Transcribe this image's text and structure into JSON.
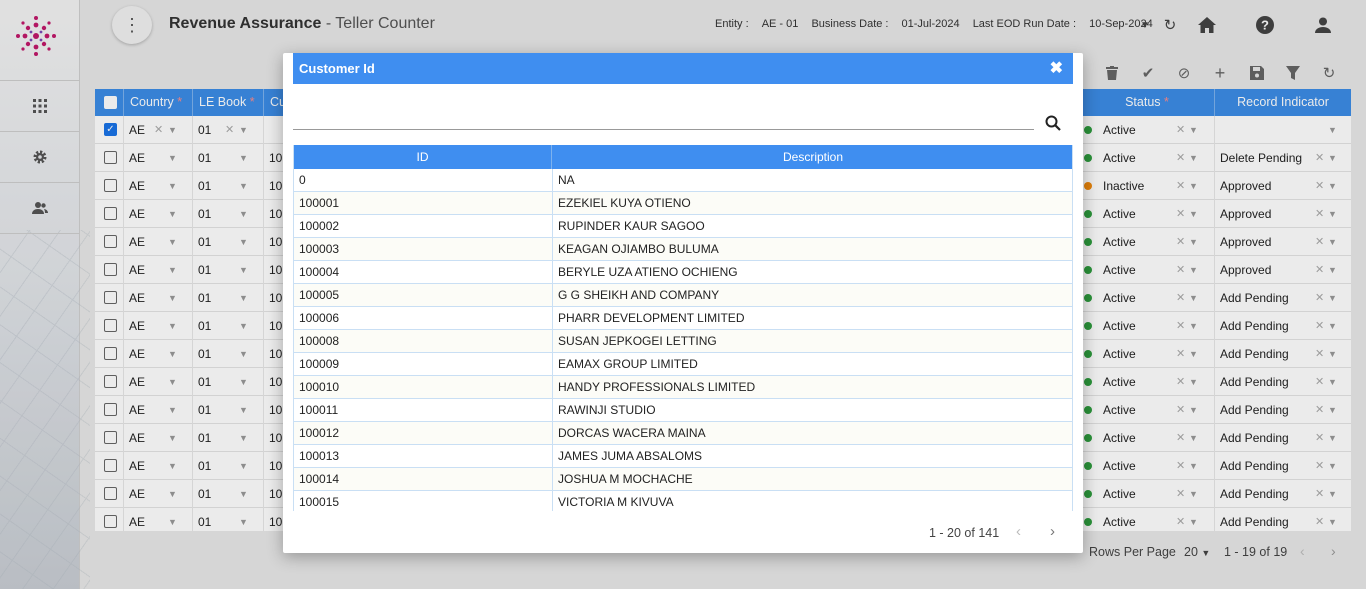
{
  "header": {
    "app_title": "Revenue Assurance",
    "app_subtitle": " - Teller Counter",
    "entity_label": "Entity : ",
    "entity_value": "AE - 01",
    "business_date_label": "Business Date : ",
    "business_date_value": "01-Jul-2024",
    "eod_label": "Last EOD Run Date : ",
    "eod_value": "10-Sep-2024"
  },
  "grid": {
    "columns": [
      {
        "label": "Country",
        "required": "*"
      },
      {
        "label": "LE Book",
        "required": "*"
      },
      {
        "label": "Cu",
        "required": ""
      },
      {
        "label": "Status",
        "required": "*"
      },
      {
        "label": "Record Indicator",
        "required": ""
      }
    ],
    "rows": [
      {
        "country": "AE",
        "le_book": "01",
        "cust": "",
        "status": "Active",
        "indicator": "",
        "checked": true
      },
      {
        "country": "AE",
        "le_book": "01",
        "cust": "10",
        "status": "Active",
        "indicator": "Delete Pending",
        "checked": false
      },
      {
        "country": "AE",
        "le_book": "01",
        "cust": "10",
        "status": "Inactive",
        "indicator": "Approved",
        "checked": false
      },
      {
        "country": "AE",
        "le_book": "01",
        "cust": "10",
        "status": "Active",
        "indicator": "Approved",
        "checked": false
      },
      {
        "country": "AE",
        "le_book": "01",
        "cust": "10",
        "status": "Active",
        "indicator": "Approved",
        "checked": false
      },
      {
        "country": "AE",
        "le_book": "01",
        "cust": "10",
        "status": "Active",
        "indicator": "Approved",
        "checked": false
      },
      {
        "country": "AE",
        "le_book": "01",
        "cust": "10",
        "status": "Active",
        "indicator": "Add Pending",
        "checked": false
      },
      {
        "country": "AE",
        "le_book": "01",
        "cust": "10",
        "status": "Active",
        "indicator": "Add Pending",
        "checked": false
      },
      {
        "country": "AE",
        "le_book": "01",
        "cust": "10",
        "status": "Active",
        "indicator": "Add Pending",
        "checked": false
      },
      {
        "country": "AE",
        "le_book": "01",
        "cust": "10",
        "status": "Active",
        "indicator": "Add Pending",
        "checked": false
      },
      {
        "country": "AE",
        "le_book": "01",
        "cust": "10",
        "status": "Active",
        "indicator": "Add Pending",
        "checked": false
      },
      {
        "country": "AE",
        "le_book": "01",
        "cust": "10",
        "status": "Active",
        "indicator": "Add Pending",
        "checked": false
      },
      {
        "country": "AE",
        "le_book": "01",
        "cust": "10",
        "status": "Active",
        "indicator": "Add Pending",
        "checked": false
      },
      {
        "country": "AE",
        "le_book": "01",
        "cust": "10",
        "status": "Active",
        "indicator": "Add Pending",
        "checked": false
      },
      {
        "country": "AE",
        "le_book": "01",
        "cust": "10",
        "status": "Active",
        "indicator": "Add Pending",
        "checked": false
      }
    ],
    "footer": {
      "rows_per_page_label": "Rows Per Page",
      "rows_per_page_value": "20",
      "range": "1 - 19 of 19"
    }
  },
  "dialog": {
    "title": "Customer Id",
    "search_placeholder": "",
    "col_id": "ID",
    "col_desc": "Description",
    "rows": [
      {
        "id": "0",
        "desc": "NA"
      },
      {
        "id": "100001",
        "desc": "EZEKIEL KUYA OTIENO"
      },
      {
        "id": "100002",
        "desc": "RUPINDER KAUR SAGOO"
      },
      {
        "id": "100003",
        "desc": "KEAGAN OJIAMBO BULUMA"
      },
      {
        "id": "100004",
        "desc": "BERYLE UZA ATIENO OCHIENG"
      },
      {
        "id": "100005",
        "desc": "G G SHEIKH AND COMPANY"
      },
      {
        "id": "100006",
        "desc": "PHARR DEVELOPMENT LIMITED"
      },
      {
        "id": "100008",
        "desc": "SUSAN JEPKOGEI LETTING"
      },
      {
        "id": "100009",
        "desc": "EAMAX GROUP LIMITED"
      },
      {
        "id": "100010",
        "desc": "HANDY PROFESSIONALS LIMITED"
      },
      {
        "id": "100011",
        "desc": "RAWINJI STUDIO"
      },
      {
        "id": "100012",
        "desc": "DORCAS WACERA MAINA"
      },
      {
        "id": "100013",
        "desc": "JAMES JUMA ABSALOMS"
      },
      {
        "id": "100014",
        "desc": "JOSHUA M MOCHACHE"
      },
      {
        "id": "100015",
        "desc": "VICTORIA M KIVUVA"
      }
    ],
    "pager": "1 - 20 of 141"
  },
  "colors": {
    "accent": "#3f8ef0",
    "status_active": "#2e9e3e",
    "status_inactive": "#f0890c",
    "brand": "#c2186b"
  },
  "icons": [
    "menu-dots-icon",
    "refresh-icon",
    "home-icon",
    "help-icon",
    "user-icon",
    "apps-grid-icon",
    "settings-gear-icon",
    "users-icon",
    "delete-icon",
    "approve-check-icon",
    "reject-icon",
    "add-icon",
    "save-icon",
    "filter-icon",
    "close-icon",
    "search-icon"
  ]
}
